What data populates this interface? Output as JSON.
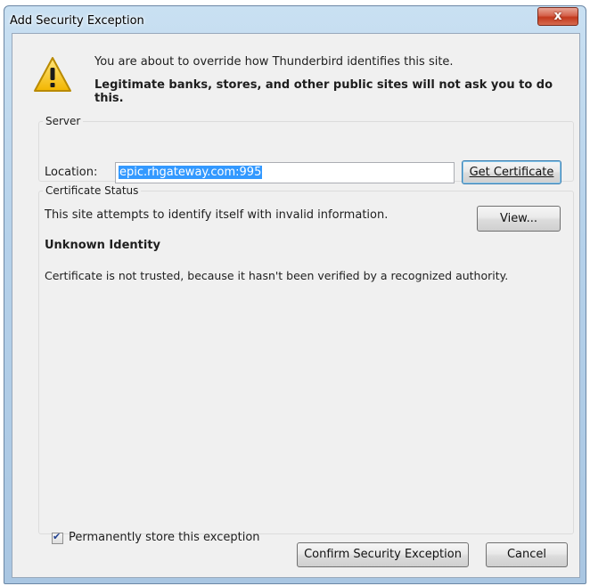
{
  "window": {
    "title": "Add Security Exception",
    "close_glyph": "x"
  },
  "warning": {
    "icon": "warning-triangle-icon",
    "line1": "You are about to override how Thunderbird identifies this site.",
    "line2": "Legitimate banks, stores, and other public sites will not ask you to do this."
  },
  "server": {
    "legend": "Server",
    "location_label": "Location:",
    "location_value": "epic.rhgateway.com:995",
    "get_certificate_button": "Get Certificate"
  },
  "certificate_status": {
    "legend": "Certificate Status",
    "message": "This site attempts to identify itself with invalid information.",
    "view_button": "View...",
    "identity_heading": "Unknown Identity",
    "detail": "Certificate is not trusted, because it hasn't been verified by a recognized authority."
  },
  "footer": {
    "permanent_checkbox_label": "Permanently store this exception",
    "permanent_checked": true,
    "confirm_button": "Confirm Security Exception",
    "cancel_button": "Cancel"
  }
}
